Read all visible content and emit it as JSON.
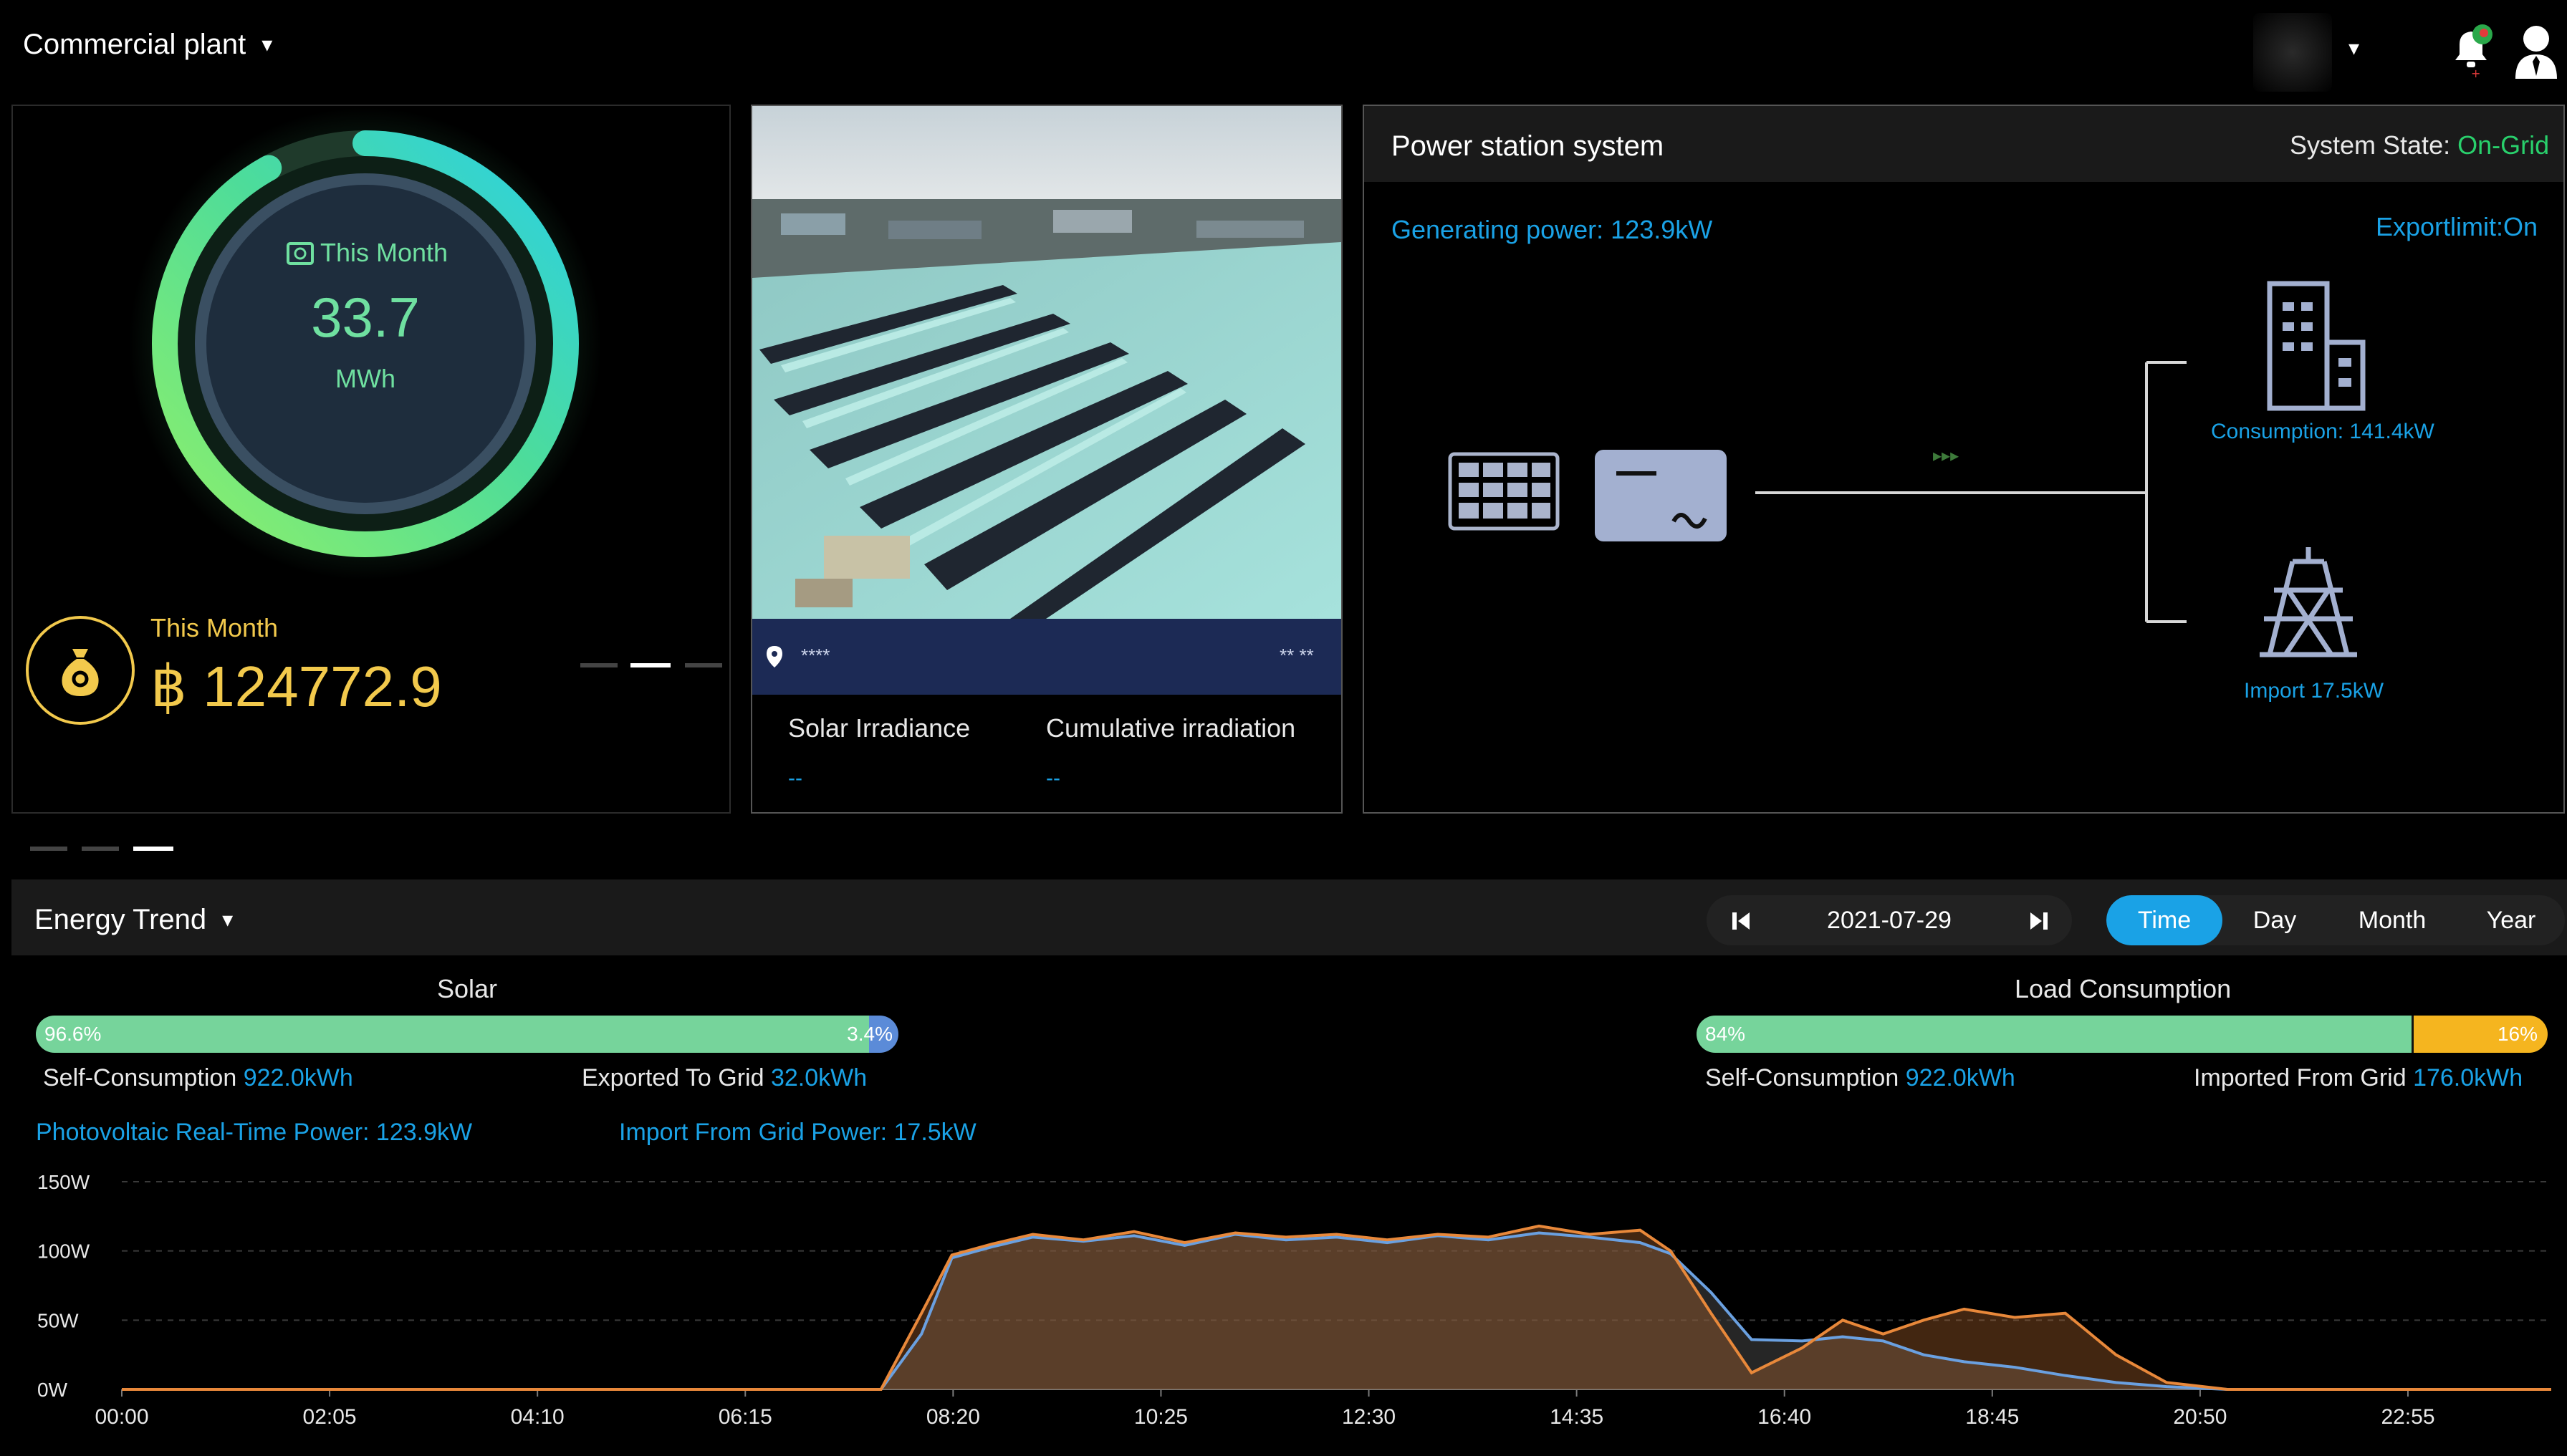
{
  "topbar": {
    "plant_name": "Commercial plant",
    "dropdown_caret": "▾"
  },
  "summary": {
    "month_label": "This Month",
    "month_energy": "33.7",
    "month_energy_unit": "MWh",
    "month_progress": 0.92,
    "income_label": "This Month",
    "income_value": "฿ 124772.9"
  },
  "photo_card": {
    "location": "****",
    "location_right": "** **",
    "irradiance_label": "Solar Irradiance",
    "irradiance_value": "--",
    "cumulative_label": "Cumulative irradiation",
    "cumulative_value": "--"
  },
  "system": {
    "title": "Power station system",
    "state_label": "System State: ",
    "state_value": "On-Grid",
    "generating_power": "Generating power:   123.9kW",
    "export_limit": "Exportlimit:On",
    "consumption": "Consumption: 141.4kW",
    "import": "Import 17.5kW",
    "flow_arrows": "▸▸▸"
  },
  "trend": {
    "title": "Energy Trend",
    "date": "2021-07-29",
    "tabs": [
      "Time",
      "Day",
      "Month",
      "Year"
    ],
    "active_tab": "Time",
    "solar": {
      "title": "Solar",
      "self_pct": "96.6%",
      "export_pct": "3.4%",
      "self_share": 0.966,
      "self_label": "Self-Consumption ",
      "self_value": "922.0kWh",
      "export_label": "Exported To Grid ",
      "export_value": "32.0kWh"
    },
    "load": {
      "title": "Load Consumption",
      "self_pct": "84%",
      "import_pct": "16%",
      "self_share": 0.84,
      "self_label": "Self-Consumption ",
      "self_value": "922.0kWh",
      "import_label": "Imported From Grid ",
      "import_value": "176.0kWh"
    },
    "pv_power": "Photovoltaic Real-Time Power:   123.9kW",
    "grid_power": "Import From Grid Power:   17.5kW"
  },
  "colors": {
    "accent_blue": "#1aa2e6",
    "green": "#76d49b",
    "gold": "#f2c94c",
    "orange": "#e8883a",
    "series_blue": "#6aa0e0"
  },
  "chart_data": {
    "type": "area",
    "y_ticks": [
      "0W",
      "50W",
      "100W",
      "150W"
    ],
    "ylim": [
      0,
      150
    ],
    "x_ticks": [
      "00:00",
      "02:05",
      "04:10",
      "06:15",
      "08:20",
      "10:25",
      "12:30",
      "14:35",
      "16:40",
      "18:45",
      "20:50",
      "22:55"
    ],
    "x_hours": [
      0,
      24
    ],
    "grid": true,
    "series": [
      {
        "color": "#6aa0e0",
        "points": [
          [
            0,
            0
          ],
          [
            7.5,
            0
          ],
          [
            7.9,
            40
          ],
          [
            8.2,
            95
          ],
          [
            8.6,
            103
          ],
          [
            9.0,
            110
          ],
          [
            9.5,
            107
          ],
          [
            10.0,
            111
          ],
          [
            10.5,
            104
          ],
          [
            11.0,
            112
          ],
          [
            11.5,
            108
          ],
          [
            12.0,
            110
          ],
          [
            12.5,
            106
          ],
          [
            13.0,
            111
          ],
          [
            13.5,
            108
          ],
          [
            14.0,
            113
          ],
          [
            14.5,
            110
          ],
          [
            15.0,
            106
          ],
          [
            15.3,
            98
          ],
          [
            15.7,
            70
          ],
          [
            16.1,
            36
          ],
          [
            16.6,
            35
          ],
          [
            17.0,
            38
          ],
          [
            17.4,
            35
          ],
          [
            17.8,
            25
          ],
          [
            18.2,
            20
          ],
          [
            18.7,
            16
          ],
          [
            19.2,
            10
          ],
          [
            19.7,
            5
          ],
          [
            20.2,
            2
          ],
          [
            20.8,
            0
          ],
          [
            24,
            0
          ]
        ]
      },
      {
        "color": "#e8883a",
        "points": [
          [
            0,
            0
          ],
          [
            7.5,
            0
          ],
          [
            7.9,
            55
          ],
          [
            8.2,
            97
          ],
          [
            8.6,
            105
          ],
          [
            9.0,
            112
          ],
          [
            9.5,
            108
          ],
          [
            10.0,
            114
          ],
          [
            10.5,
            106
          ],
          [
            11.0,
            113
          ],
          [
            11.5,
            110
          ],
          [
            12.0,
            112
          ],
          [
            12.5,
            108
          ],
          [
            13.0,
            112
          ],
          [
            13.5,
            110
          ],
          [
            14.0,
            118
          ],
          [
            14.5,
            112
          ],
          [
            15.0,
            115
          ],
          [
            15.3,
            100
          ],
          [
            15.7,
            55
          ],
          [
            16.1,
            12
          ],
          [
            16.6,
            30
          ],
          [
            17.0,
            50
          ],
          [
            17.4,
            40
          ],
          [
            17.8,
            50
          ],
          [
            18.2,
            58
          ],
          [
            18.7,
            52
          ],
          [
            19.2,
            55
          ],
          [
            19.7,
            25
          ],
          [
            20.2,
            5
          ],
          [
            20.8,
            0
          ],
          [
            24,
            0
          ]
        ]
      }
    ]
  }
}
